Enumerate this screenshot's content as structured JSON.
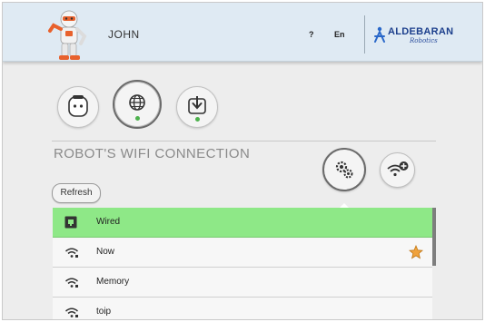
{
  "header": {
    "robot_name": "JOHN",
    "help_label": "?",
    "language_label": "En",
    "brand_name": "ALDEBARAN",
    "brand_sub": "Robotics"
  },
  "tabs": [
    {
      "icon": "robot-face-icon",
      "active": false
    },
    {
      "icon": "globe-icon",
      "active": true,
      "status": "connected"
    },
    {
      "icon": "download-icon",
      "active": false,
      "status": "connected"
    }
  ],
  "section": {
    "title": "ROBOT'S WIFI CONNECTION"
  },
  "actions": {
    "settings_icon": "gears-icon",
    "add_wifi_icon": "wifi-add-icon",
    "refresh_label": "Refresh"
  },
  "networks": [
    {
      "name": "Wired",
      "type": "wired",
      "selected": true,
      "favorite": false
    },
    {
      "name": "Now",
      "type": "wifi",
      "selected": false,
      "favorite": true
    },
    {
      "name": "Memory",
      "type": "wifi",
      "selected": false,
      "favorite": false
    },
    {
      "name": "toip",
      "type": "wifi",
      "selected": false,
      "favorite": false
    }
  ],
  "colors": {
    "header_bg": "#dfeaf3",
    "selected_row": "#8ee887",
    "status_dot": "#4db24d",
    "favorite_star": "#f0a23c",
    "brand": "#1c3f8c"
  }
}
